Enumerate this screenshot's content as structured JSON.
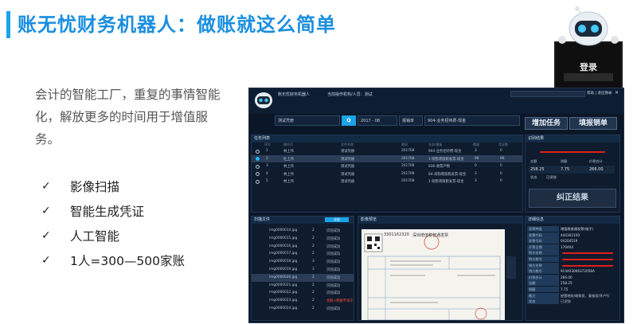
{
  "page": {
    "title": "账无忧财务机器人：做账就这么简单",
    "description": "会计的智能工厂，重复的事情智能化，解放更多的时间用于增值服务。",
    "check_mark": "✓",
    "features": [
      "影像扫描",
      "智能生成凭证",
      "人工智能",
      "1人=300—500家账"
    ],
    "accent_color": "#1aa3e8"
  },
  "robot": {
    "login_label": "登录"
  },
  "app": {
    "app_name": "账无忧财务机器人",
    "subtitle": "当前操作机构/人员：测试",
    "topbar_links": "帮助 | 退出登录",
    "win_min": "—",
    "win_close": "✕",
    "search_value": "测试凭册",
    "search_button": "Q",
    "date_value": "2017 - 08",
    "report_label": "报销单",
    "biz_value": "904-业务招待费-现金",
    "add_task_button": "增加任务",
    "submit_button": "填报销单",
    "task_panel": {
      "title": "任务列表",
      "columns": [
        "",
        "序号",
        "操作员",
        "文件名称",
        "期间",
        "业务/模板",
        "数量",
        "凭证数"
      ],
      "rows": [
        {
          "selected": false,
          "no": "1",
          "user": "林上伟",
          "file": "测试凭册",
          "period": "201708",
          "biz": "904-业务招待费-现金",
          "qty": "3",
          "count": "0"
        },
        {
          "selected": true,
          "no": "2",
          "user": "杜上伟",
          "file": "测试凭册",
          "period": "201708",
          "biz": "1-销售增值税发票-现金",
          "qty": "96",
          "count": "96"
        },
        {
          "selected": false,
          "no": "3",
          "user": "林上伟",
          "file": "测试凭册",
          "period": "201708",
          "biz": "836-收票产物",
          "qty": "0",
          "count": "0"
        },
        {
          "selected": false,
          "no": "4",
          "user": "林上伟",
          "file": "测试凭册",
          "period": "201708",
          "biz": "84-采购增值税发票-现金",
          "qty": "3",
          "count": "0"
        },
        {
          "selected": false,
          "no": "5",
          "user": "林上伟",
          "file": "测试凭册",
          "period": "201708",
          "biz": "1-销售增值税发票-现金",
          "qty": "3",
          "count": "0"
        }
      ]
    },
    "image_panel": {
      "title": "扫描文件",
      "filter_label": "全部",
      "rows": [
        {
          "name": "img0000014.jpg",
          "qty": "2",
          "status": "识别成功",
          "red": false,
          "selected": false
        },
        {
          "name": "img0000015.jpg",
          "qty": "2",
          "status": "识别成功",
          "red": false,
          "selected": false
        },
        {
          "name": "img0000016.jpg",
          "qty": "2",
          "status": "识别成功",
          "red": false,
          "selected": false
        },
        {
          "name": "img0000017.jpg",
          "qty": "2",
          "status": "识别成功",
          "red": false,
          "selected": false
        },
        {
          "name": "img0000018.jpg",
          "qty": "3",
          "status": "识别成功",
          "red": false,
          "selected": false
        },
        {
          "name": "img0000019.jpg",
          "qty": "3",
          "status": "识别成功",
          "red": false,
          "selected": false
        },
        {
          "name": "img0000020.jpg",
          "qty": "2",
          "status": "识别成功",
          "red": false,
          "selected": true
        },
        {
          "name": "img0000021.jpg",
          "qty": "2",
          "status": "识别成功",
          "red": false,
          "selected": false
        },
        {
          "name": "img0000022.jpg",
          "qty": "2",
          "status": "识别成功",
          "red": false,
          "selected": false
        },
        {
          "name": "img0000023.jpg",
          "qty": "2",
          "status": "金额+税额不等于价税合计",
          "red": true,
          "selected": false
        },
        {
          "name": "img0000024.jpg",
          "qty": "2",
          "status": "识别成功",
          "red": false,
          "selected": false
        }
      ]
    },
    "preview_panel": {
      "title": "影像预览",
      "invoice_no": "3301162320",
      "invoice_title": "深圳增值税普通发票"
    },
    "result_panel": {
      "title": "识别结果",
      "grid_headers": [
        "金额",
        "税额",
        "价税合计"
      ],
      "grid_values": [
        "258.25",
        "7.75",
        "266.00"
      ],
      "status_key": "状态",
      "status_value": "已识别",
      "correct_button": "纠正结果"
    },
    "detail_panel": {
      "title": "详细信息",
      "rows": [
        {
          "k": "发票种类",
          "v": "增值税普通发票(电子)"
        },
        {
          "k": "发票代码",
          "v": "440302100"
        },
        {
          "k": "发票号码",
          "v": "04204519"
        },
        {
          "k": "开票日期",
          "v": "170404"
        },
        {
          "k": "购方名称",
          "v": ""
        },
        {
          "k": "购方税号",
          "v": ""
        },
        {
          "k": "销方名称",
          "v": ""
        },
        {
          "k": "销方税号",
          "v": "914403006372058A"
        },
        {
          "k": "价税合计",
          "v": "266.00"
        },
        {
          "k": "金额",
          "v": "258.25"
        },
        {
          "k": "税额",
          "v": "7.75"
        },
        {
          "k": "备注",
          "v": "经营地址/收款员、复核员/开户行"
        },
        {
          "k": "状态",
          "v": "已识别"
        }
      ]
    }
  }
}
